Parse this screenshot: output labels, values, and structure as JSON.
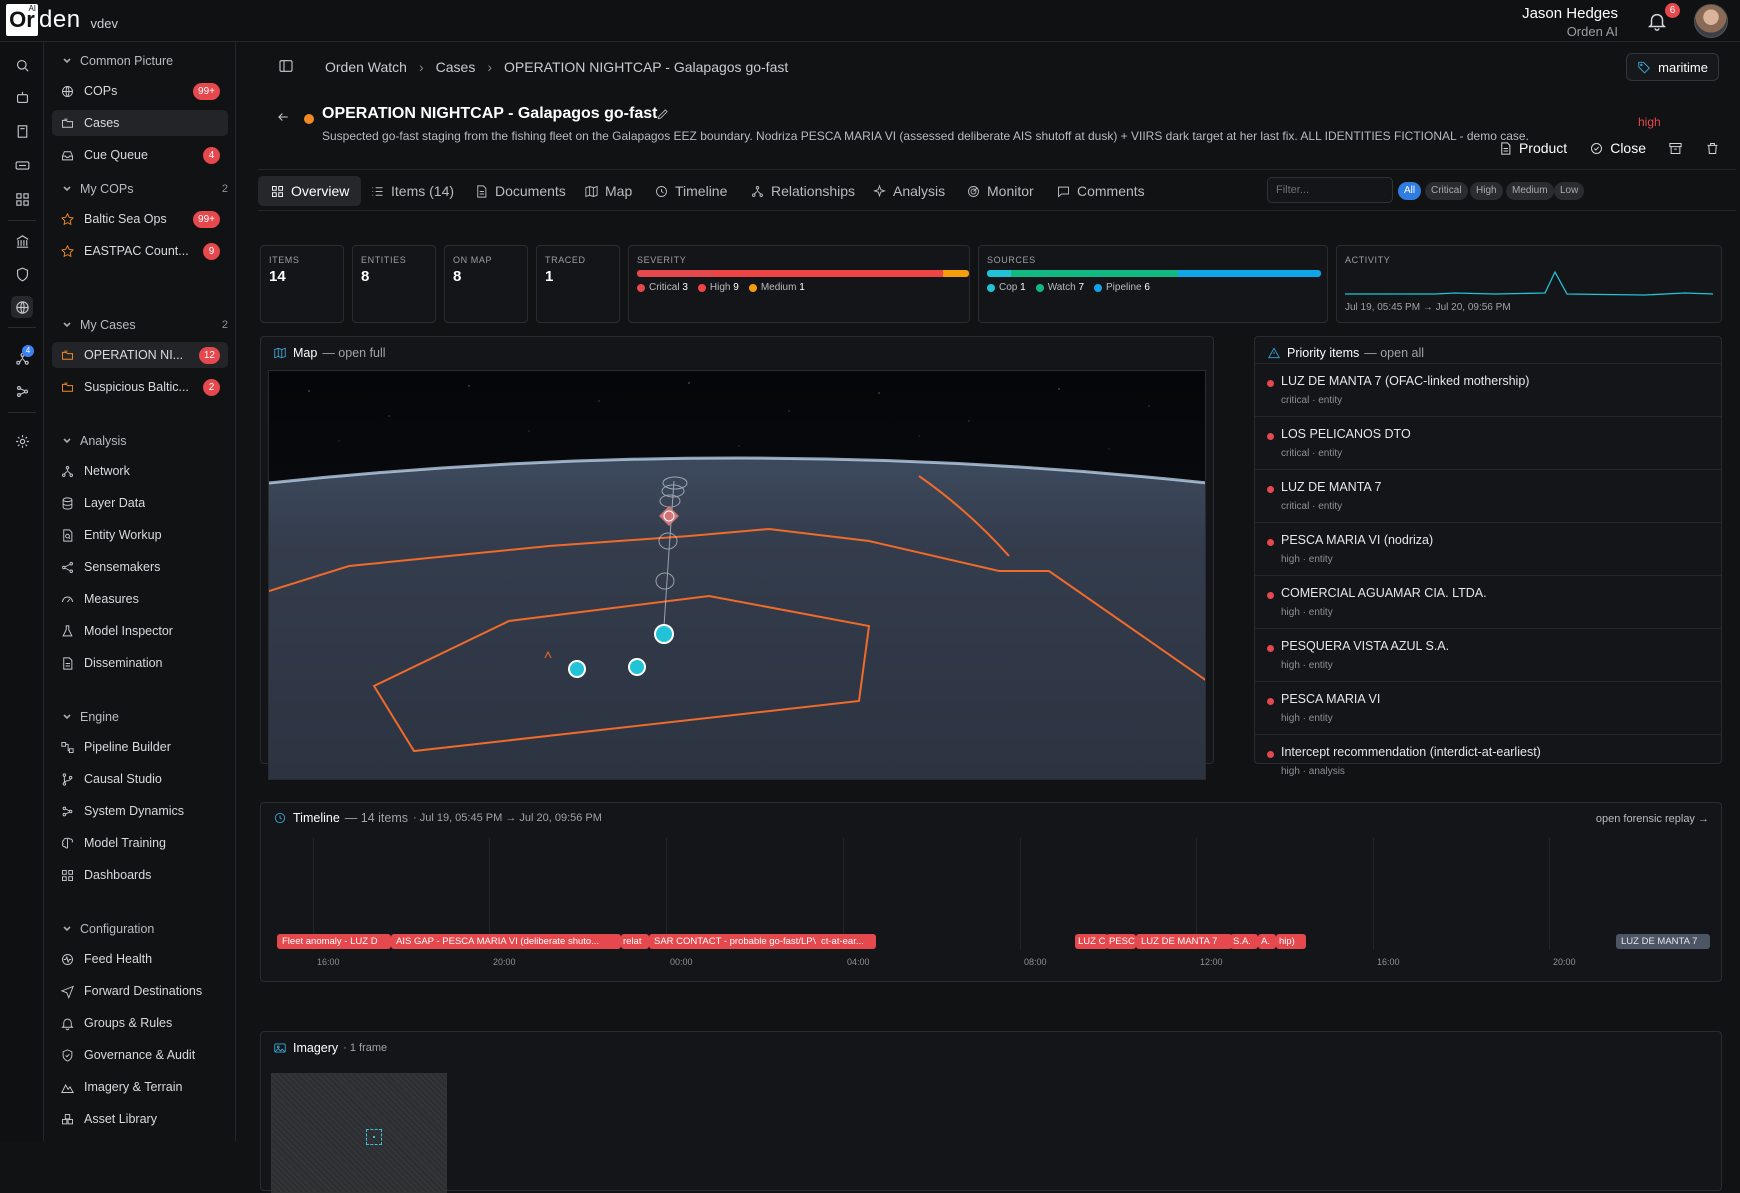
{
  "app": {
    "logo_letter": "Or",
    "logo_ai": "AI",
    "logo_rest": "den",
    "env": "vdev"
  },
  "user": {
    "name": "Jason Hedges",
    "org": "Orden AI",
    "notifications": "6"
  },
  "rail": {
    "badge": "4"
  },
  "sidebar": {
    "common": {
      "title": "Common Picture",
      "items": [
        {
          "label": "COPs",
          "badge": "99+"
        },
        {
          "label": "Cases",
          "badge": ""
        },
        {
          "label": "Cue Queue",
          "badge": "4"
        }
      ]
    },
    "my_cops": {
      "title": "My COPs",
      "count": "2",
      "items": [
        {
          "label": "Baltic Sea Ops",
          "badge": "99+"
        },
        {
          "label": "EASTPAC Count...",
          "badge": "9"
        }
      ]
    },
    "my_cases": {
      "title": "My Cases",
      "count": "2",
      "items": [
        {
          "label": "OPERATION NI...",
          "badge": "12"
        },
        {
          "label": "Suspicious Baltic...",
          "badge": "2"
        }
      ]
    },
    "analysis": {
      "title": "Analysis",
      "items": [
        "Network",
        "Layer Data",
        "Entity Workup",
        "Sensemakers",
        "Measures",
        "Model Inspector",
        "Dissemination"
      ]
    },
    "engine": {
      "title": "Engine",
      "items": [
        "Pipeline Builder",
        "Causal Studio",
        "System Dynamics",
        "Model Training",
        "Dashboards"
      ]
    },
    "config": {
      "title": "Configuration",
      "items": [
        "Feed Health",
        "Forward Destinations",
        "Groups & Rules",
        "Governance & Audit",
        "Imagery & Terrain",
        "Asset Library"
      ]
    }
  },
  "breadcrumb": [
    "Orden Watch",
    "Cases",
    "OPERATION NIGHTCAP - Galapagos go-fast"
  ],
  "tag": "maritime",
  "case": {
    "title": "OPERATION NIGHTCAP - Galapagos go-fast",
    "description": "Suspected go-fast staging from the fishing fleet on the Galapagos EEZ boundary. Nodriza PESCA MARIA VI (assessed deliberate AIS shutoff at dusk) + VIIRS dark target at her last fix. ALL IDENTITIES FICTIONAL - demo case.",
    "severity": "high",
    "actions": [
      "Product",
      "Close"
    ]
  },
  "tabs": [
    "Overview",
    "Items (14)",
    "Documents",
    "Map",
    "Timeline",
    "Relationships",
    "Analysis",
    "Monitor",
    "Comments"
  ],
  "filter": {
    "placeholder": "Filter...",
    "pills": [
      "All",
      "Critical",
      "High",
      "Medium",
      "Low"
    ]
  },
  "stats": {
    "items": {
      "label": "ITEMS",
      "value": "14"
    },
    "entities": {
      "label": "ENTITIES",
      "value": "8"
    },
    "on_map": {
      "label": "ON MAP",
      "value": "8"
    },
    "traced": {
      "label": "TRACED",
      "value": "1"
    },
    "severity": {
      "label": "SEVERITY",
      "critical": 3,
      "high": 9,
      "medium": 1,
      "labels": [
        "Critical",
        "High",
        "Medium"
      ],
      "colors": [
        "#e5484d",
        "#ef4444",
        "#f59e0b"
      ]
    },
    "sources": {
      "label": "SOURCES",
      "cop": 1,
      "watch": 7,
      "pipeline": 6,
      "labels": [
        "Cop",
        "Watch",
        "Pipeline"
      ],
      "colors": [
        "#22c3d6",
        "#10b981",
        "#0ea5e9"
      ]
    },
    "activity": {
      "label": "ACTIVITY",
      "range": "Jul 19, 05:45 PM → Jul 20, 09:56 PM"
    }
  },
  "map": {
    "title": "Map",
    "sub": "— open full"
  },
  "priority": {
    "title": "Priority items",
    "sub": "— open all",
    "items": [
      {
        "title": "LUZ DE MANTA 7 (OFAC-linked mothership)",
        "sub": "critical · entity"
      },
      {
        "title": "LOS PELICANOS DTO",
        "sub": "critical · entity"
      },
      {
        "title": "LUZ DE MANTA 7",
        "sub": "critical · entity"
      },
      {
        "title": "PESCA MARIA VI (nodriza)",
        "sub": "high · entity"
      },
      {
        "title": "COMERCIAL AGUAMAR CIA. LTDA.",
        "sub": "high · entity"
      },
      {
        "title": "PESQUERA VISTA AZUL S.A.",
        "sub": "high · entity"
      },
      {
        "title": "PESCA MARIA VI",
        "sub": "high · entity"
      },
      {
        "title": "Intercept recommendation (interdict-at-earliest)",
        "sub": "high · analysis"
      }
    ]
  },
  "timeline": {
    "title": "Timeline",
    "count": "— 14 items",
    "range": "· Jul 19, 05:45 PM → Jul 20, 09:56 PM",
    "open": "open forensic replay →",
    "ticks": [
      "16:00",
      "20:00",
      "00:00",
      "04:00",
      "08:00",
      "12:00",
      "16:00",
      "20:00"
    ],
    "events": [
      "Fleet anomaly - LUZ D",
      "AIS GAP - PESCA MARIA VI (deliberate shuto...",
      "relat",
      "SAR CONTACT - probable go-fast/LPV (CFAR)",
      "ct-at-ear...",
      "LUZ CO",
      "PESC",
      "LUZ DE MANTA 7",
      "S.A.",
      "A.",
      "hip)",
      "LUZ DE MANTA 7"
    ]
  },
  "imagery": {
    "title": "Imagery",
    "count": "· 1 frame"
  }
}
